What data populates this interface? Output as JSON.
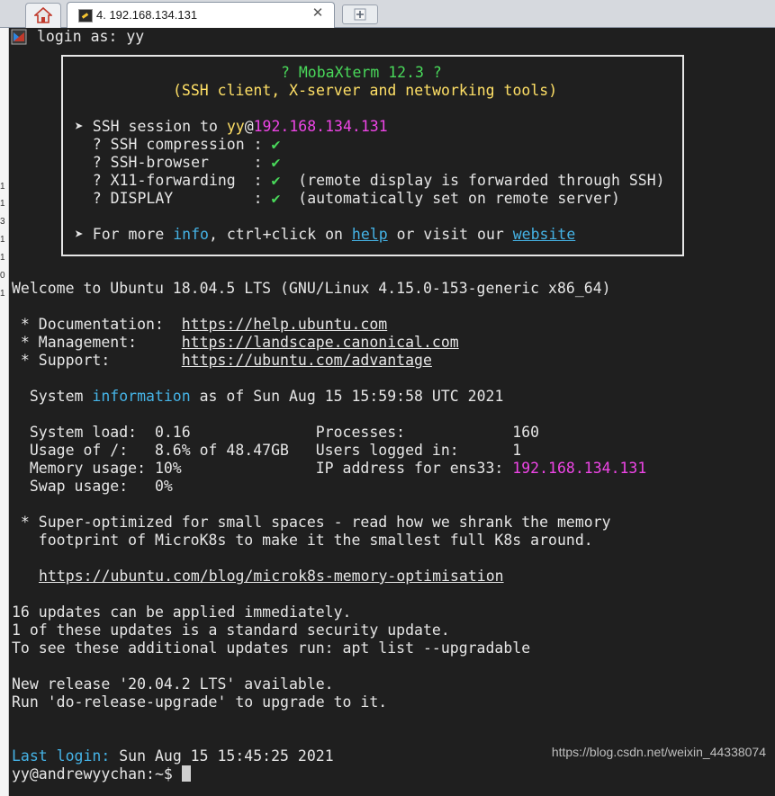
{
  "tabs": {
    "home_icon": "home-icon",
    "session_title": "4. 192.168.134.131",
    "close": "✕",
    "new_tab_icon": "plus-icon"
  },
  "sliver": [
    "1",
    "1",
    "3",
    "1",
    "1",
    "0",
    "1"
  ],
  "terminal": {
    "login_prompt": "login as: ",
    "login_user": "yy",
    "banner_title": "? MobaXterm 12.3 ?",
    "banner_subtitle": "(SSH client, X-server and networking tools)",
    "ssh_prefix": " ➤ SSH session to ",
    "ssh_user": "yy",
    "ssh_at": "@",
    "ssh_host": "192.168.134.131",
    "feat_compression": "   ? SSH compression : ",
    "feat_browser": "   ? SSH-browser     : ",
    "feat_x11": "   ? X11-forwarding  : ",
    "feat_x11_note": "  (remote display is forwarded through SSH)",
    "feat_display": "   ? DISPLAY         : ",
    "feat_display_note": "  (automatically set on remote server)",
    "check": "✔",
    "more_prefix": " ➤ For more ",
    "more_info": "info",
    "more_mid": ", ctrl+click on ",
    "more_help": "help",
    "more_mid2": " or visit our ",
    "more_website": "website",
    "welcome": "Welcome to Ubuntu 18.04.5 LTS (GNU/Linux 4.15.0-153-generic x86_64)",
    "doc_label": " * Documentation:  ",
    "doc_url": "https://help.ubuntu.com",
    "mgmt_label": " * Management:     ",
    "mgmt_url": "https://landscape.canonical.com",
    "support_label": " * Support:        ",
    "support_url": "https://ubuntu.com/advantage",
    "sysinfo_prefix": "  System ",
    "sysinfo_word": "information",
    "sysinfo_suffix": " as of Sun Aug 15 15:59:58 UTC 2021",
    "row_load": "  System load:  0.16              Processes:            160",
    "row_usage": "  Usage of /:   8.6% of 48.47GB   Users logged in:      1",
    "row_mem": "  Memory usage: 10%               IP address for ens33: ",
    "ip_value": "192.168.134.131",
    "row_swap": "  Swap usage:   0%",
    "micro_1": " * Super-optimized for small spaces - read how we shrank the memory",
    "micro_2": "   footprint of MicroK8s to make it the smallest full K8s around.",
    "micro_url": "https://ubuntu.com/blog/microk8s-memory-optimisation",
    "updates_1": "16 updates can be applied immediately.",
    "updates_2": "1 of these updates is a standard security update.",
    "updates_3": "To see these additional updates run: apt list --upgradable",
    "release_1": "New release '20.04.2 LTS' available.",
    "release_2": "Run 'do-release-upgrade' to upgrade to it.",
    "last_login_label": "Last login:",
    "last_login_value": " Sun Aug 15 15:45:25 2021",
    "prompt": "yy@andrewyychan:~$ "
  },
  "watermark": "https://blog.csdn.net/weixin_44338074",
  "colors": {
    "terminal_bg": "#1f1f1f",
    "text": "#e6e6e6",
    "yellow": "#ffe066",
    "green": "#49d85a",
    "magenta": "#ee45e6",
    "cyan": "#45b3e6"
  }
}
